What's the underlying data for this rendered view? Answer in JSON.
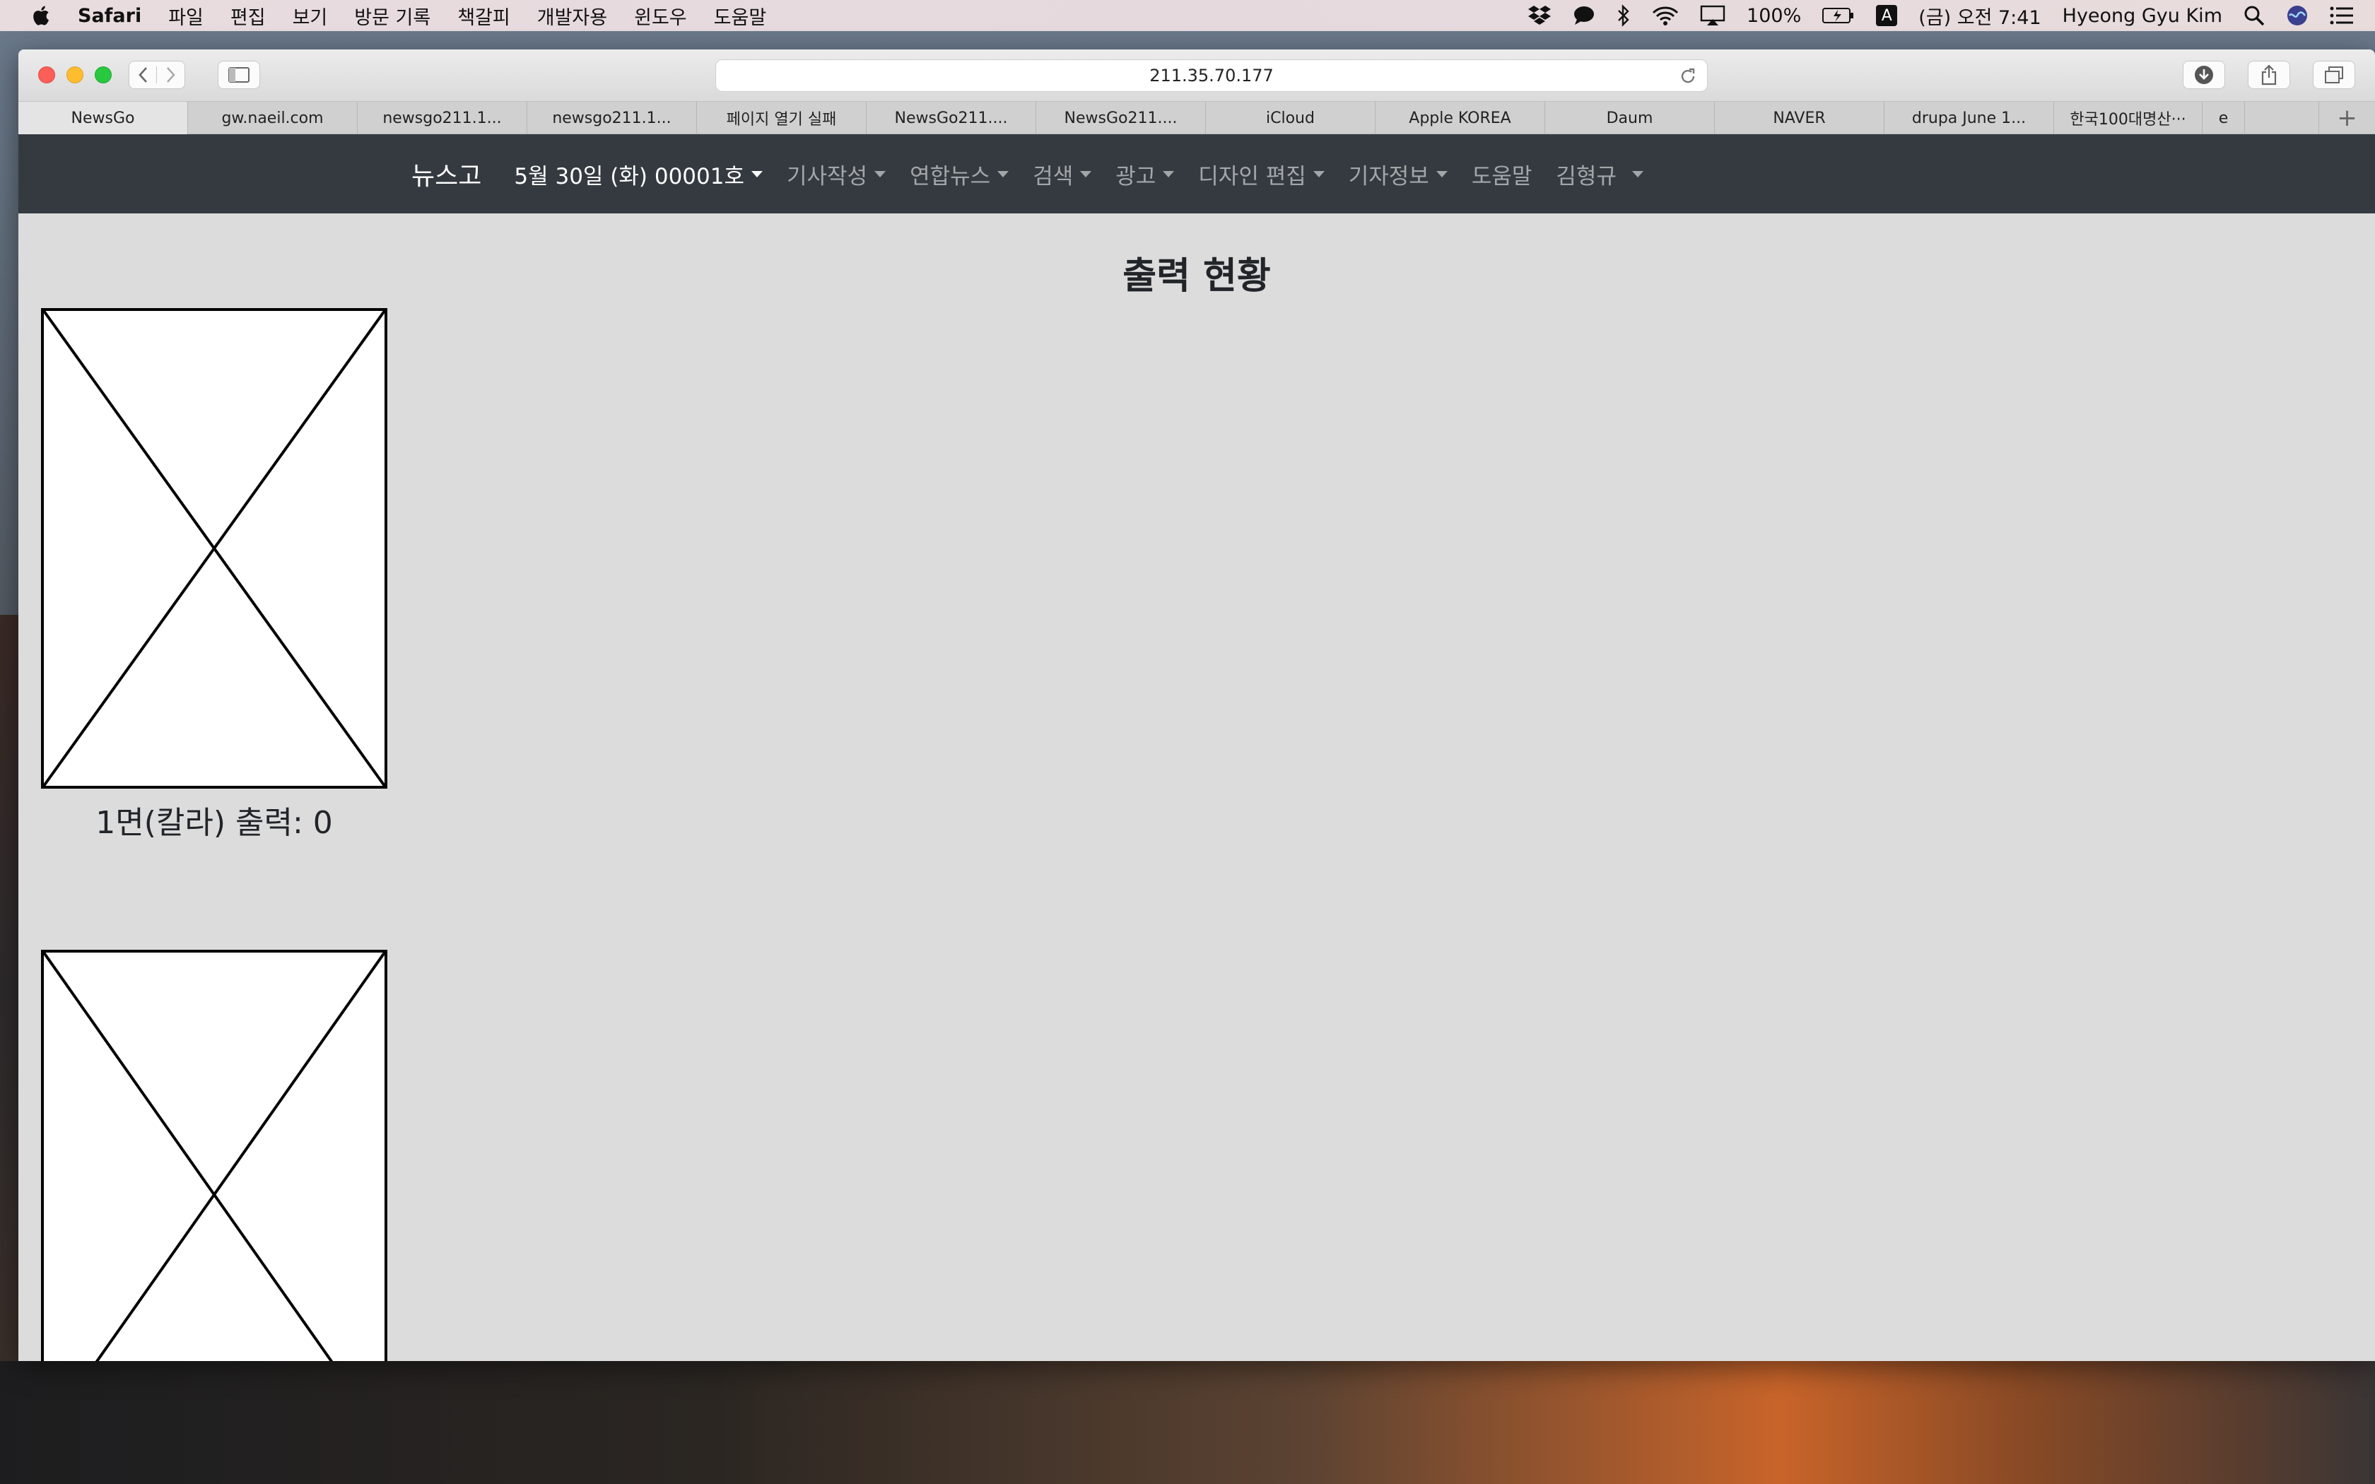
{
  "menubar": {
    "app_name": "Safari",
    "menus": [
      "파일",
      "편집",
      "보기",
      "방문 기록",
      "책갈피",
      "개발자용",
      "윈도우",
      "도움말"
    ],
    "battery": "100%",
    "input_source": "A",
    "clock": "(금) 오전 7:41",
    "user": "Hyeong Gyu Kim"
  },
  "browser": {
    "url": "211.35.70.177",
    "tabs": [
      "NewsGo",
      "gw.naeil.com",
      "newsgo211.1...",
      "newsgo211.1...",
      "페이지 열기 실패",
      "NewsGo211....",
      "NewsGo211....",
      "iCloud",
      "Apple KOREA",
      "Daum",
      "NAVER",
      "drupa June 1...",
      "한국100대명산···",
      "e"
    ],
    "new_tab": "+"
  },
  "navbar": {
    "brand": "뉴스고",
    "issue": "5월 30일 (화) 00001호",
    "items": [
      "기사작성",
      "연합뉴스",
      "검색",
      "광고",
      "디자인 편집",
      "기자정보",
      "도움말",
      "김형규"
    ]
  },
  "main": {
    "title": "출력 현황",
    "pages": [
      {
        "caption": "1면(칼라) 출력: 0"
      }
    ]
  }
}
